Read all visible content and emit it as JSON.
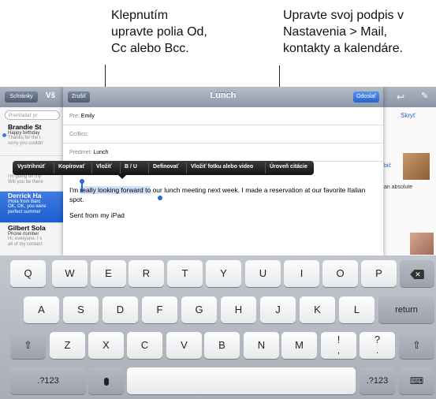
{
  "callouts": {
    "left": "Klepnutím\nupravte polia Od,\nCc alebo Bcc.",
    "right": "Upravte svoj podpis v\nNastavenia > Mail,\nkontakty a kalendáre."
  },
  "background_mail": {
    "mailboxes_button": "Schránky",
    "title_fragment": "Vš",
    "search_placeholder": "Prehľadať pr",
    "hide_link": "Skryť",
    "messages": [
      {
        "from": "Brandie St",
        "subject": "Happy birthday",
        "preview": "Thanks for the t\nsorry you couldn'"
      },
      {
        "from": "",
        "subject": "",
        "preview": "I'm going on my\nWill you be there"
      },
      {
        "from": "Derrick Ha",
        "subject": "iHola from Barc",
        "preview": "OK, OK, you were\nperfect summer"
      },
      {
        "from": "Gilbert Sola",
        "subject": "Phone number",
        "preview": "Hi, everyone. I s\nall of my contact"
      }
    ],
    "right_snippet_1": "bič",
    "right_snippet_2": "an absolute"
  },
  "compose": {
    "cancel": "Zrušiť",
    "title": "Lunch",
    "send": "Odoslať",
    "to_label": "Pre:",
    "to_value": "Emily",
    "ccbcc_label": "Cc/Bcc:",
    "subject_label": "Predmet:",
    "subject_value": "Lunch",
    "body_pre": "I'm ",
    "body_sel": "really looking forward to",
    "body_post": " our lunch meeting next week. I made a reservation at our favorite Italian spot.",
    "signature": "Sent from my iPad"
  },
  "edit_menu": [
    "Vystrihnúť",
    "Kopírovať",
    "Vložiť",
    "B / U",
    "Definovať",
    "Vložiť fotku alebo video",
    "Úroveň citácie"
  ],
  "keyboard": {
    "row1": [
      "Q",
      "W",
      "E",
      "R",
      "T",
      "Y",
      "U",
      "I",
      "O",
      "P"
    ],
    "row2": [
      "A",
      "S",
      "D",
      "F",
      "G",
      "H",
      "J",
      "K",
      "L"
    ],
    "row3": [
      "Z",
      "X",
      "C",
      "V",
      "B",
      "N",
      "M",
      "!",
      "?"
    ],
    "row3_sub": [
      ",",
      "."
    ],
    "return_label": "return",
    "numbers_label": ".?123"
  }
}
